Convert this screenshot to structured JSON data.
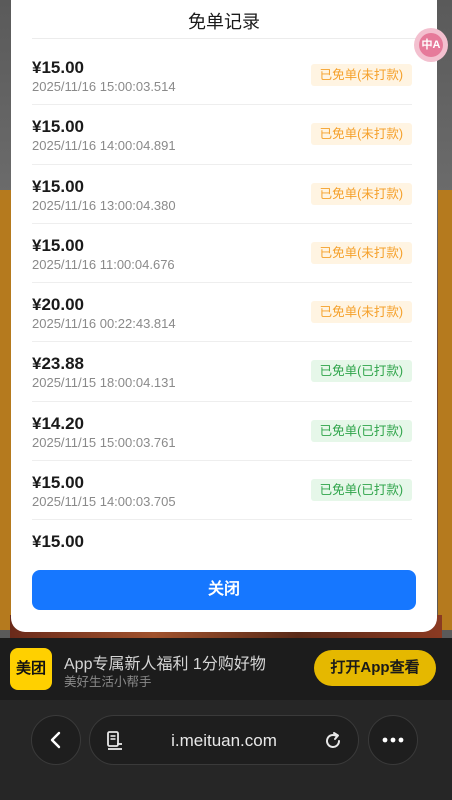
{
  "modal": {
    "title": "免单记录",
    "close_label": "关闭"
  },
  "records": [
    {
      "amount": "¥15.00",
      "time": "2025/11/16 15:00:03.514",
      "status": "已免单(未打款)",
      "state": "unpaid"
    },
    {
      "amount": "¥15.00",
      "time": "2025/11/16 14:00:04.891",
      "status": "已免单(未打款)",
      "state": "unpaid"
    },
    {
      "amount": "¥15.00",
      "time": "2025/11/16 13:00:04.380",
      "status": "已免单(未打款)",
      "state": "unpaid"
    },
    {
      "amount": "¥15.00",
      "time": "2025/11/16 11:00:04.676",
      "status": "已免单(未打款)",
      "state": "unpaid"
    },
    {
      "amount": "¥20.00",
      "time": "2025/11/16 00:22:43.814",
      "status": "已免单(未打款)",
      "state": "unpaid"
    },
    {
      "amount": "¥23.88",
      "time": "2025/11/15 18:00:04.131",
      "status": "已免单(已打款)",
      "state": "paid"
    },
    {
      "amount": "¥14.20",
      "time": "2025/11/15 15:00:03.761",
      "status": "已免单(已打款)",
      "state": "paid"
    },
    {
      "amount": "¥15.00",
      "time": "2025/11/15 14:00:03.705",
      "status": "已免单(已打款)",
      "state": "paid"
    },
    {
      "amount": "¥15.00",
      "time": "",
      "status": "",
      "state": "paid"
    }
  ],
  "float_widget": {
    "icon": "translate-icon",
    "label": "中A"
  },
  "app_banner": {
    "logo_text": "美团",
    "title": "App专属新人福利 1分购好物",
    "subtitle": "美好生活小帮手",
    "button_label": "打开App查看"
  },
  "browser": {
    "url": "i.meituan.com",
    "back_icon": "chevron-left-icon",
    "page_icon": "page-info-icon",
    "reload_icon": "reload-icon",
    "more_icon": "more-dots-icon"
  },
  "colors": {
    "primary_button": "#1677ff",
    "unpaid_text": "#f5a02a",
    "unpaid_bg": "#fff4e2",
    "paid_text": "#2fa44a",
    "paid_bg": "#e6f7e9",
    "brand_yellow": "#ffd000"
  }
}
